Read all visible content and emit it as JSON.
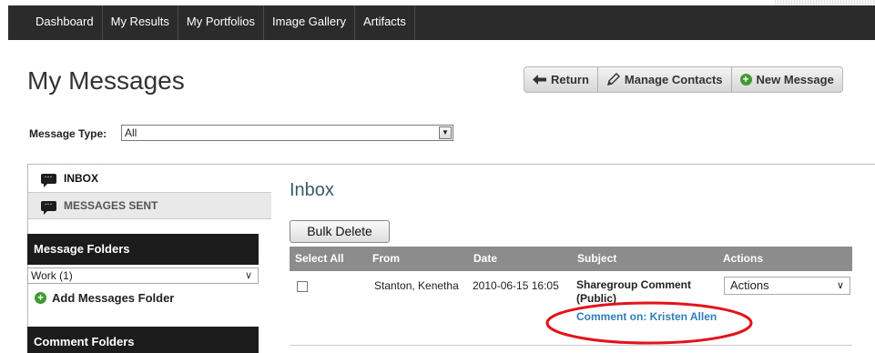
{
  "nav": {
    "items": [
      {
        "label": "Dashboard"
      },
      {
        "label": "My Results"
      },
      {
        "label": "My Portfolios"
      },
      {
        "label": "Image Gallery"
      },
      {
        "label": "Artifacts"
      }
    ]
  },
  "page": {
    "title": "My Messages"
  },
  "toolbar": {
    "return_label": "Return",
    "contacts_label": "Manage Contacts",
    "new_label": "New Message"
  },
  "filter": {
    "label": "Message Type:",
    "value": "All"
  },
  "sidebar": {
    "inbox_label": "INBOX",
    "sent_label": "MESSAGES SENT",
    "message_folders_header": "Message Folders",
    "folder_value": "Work (1)",
    "add_folder_label": "Add Messages Folder",
    "comment_folders_header": "Comment Folders"
  },
  "inbox": {
    "title": "Inbox",
    "bulk_delete_label": "Bulk Delete",
    "columns": {
      "select": "Select All",
      "from": "From",
      "date": "Date",
      "subject": "Subject",
      "actions": "Actions"
    },
    "rows": [
      {
        "from": "Stanton, Kenetha",
        "date": "2010-06-15 16:05",
        "subject": "Sharegroup Comment (Public)",
        "link": "Comment on: Kristen Allen",
        "action": "Actions"
      }
    ]
  },
  "colors": {
    "nav_bg": "#2b2b2b",
    "header_bg": "#8c8c8c",
    "link": "#2f7fb9",
    "highlight_circle": "#e3121b",
    "add_icon": "#3d9a2c"
  }
}
